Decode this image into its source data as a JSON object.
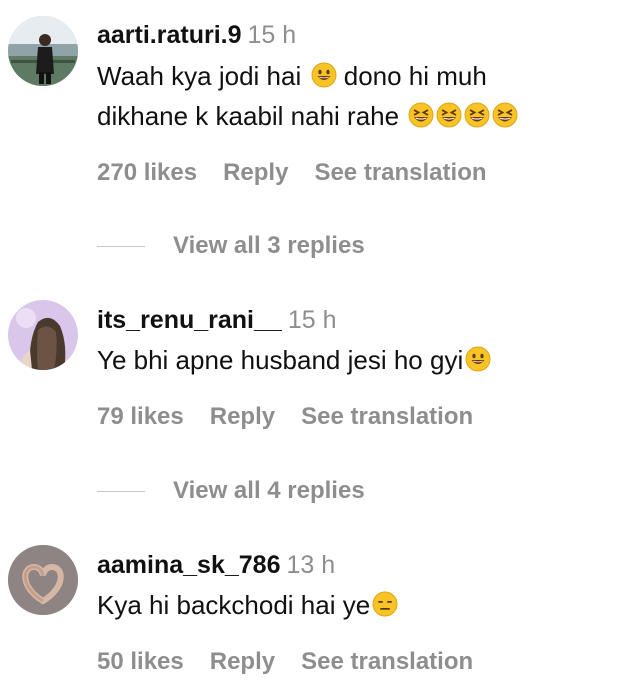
{
  "comments": [
    {
      "username": "aarti.raturi.9",
      "time": "15 h",
      "text_line1": "Waah kya jodi hai",
      "text_line1_after": "dono hi muh",
      "text_line2": "dikhane k kaabil nahi rahe",
      "emojis": [
        "grinning-face",
        "grinning-squinting-face",
        "grinning-squinting-face",
        "grinning-squinting-face",
        "grinning-squinting-face"
      ],
      "likes": "270 likes",
      "reply": "Reply",
      "translate": "See translation",
      "view_replies": "View all 3 replies"
    },
    {
      "username": "its_renu_rani__",
      "time": "15 h",
      "text": "Ye bhi apne husband jesi ho gyi",
      "emojis": [
        "grinning-face"
      ],
      "likes": "79 likes",
      "reply": "Reply",
      "translate": "See translation",
      "view_replies": "View all 4 replies"
    },
    {
      "username": "aamina_sk_786",
      "time": "13 h",
      "text": "Kya hi backchodi hai ye",
      "emojis": [
        "expressionless-face"
      ],
      "likes": "50 likes",
      "reply": "Reply",
      "translate": "See translation"
    }
  ],
  "colors": {
    "primary_text": "#111111",
    "secondary_text": "#8e8e8e",
    "divider": "#c7c7c7",
    "emoji_yellow": "#f7c325"
  }
}
